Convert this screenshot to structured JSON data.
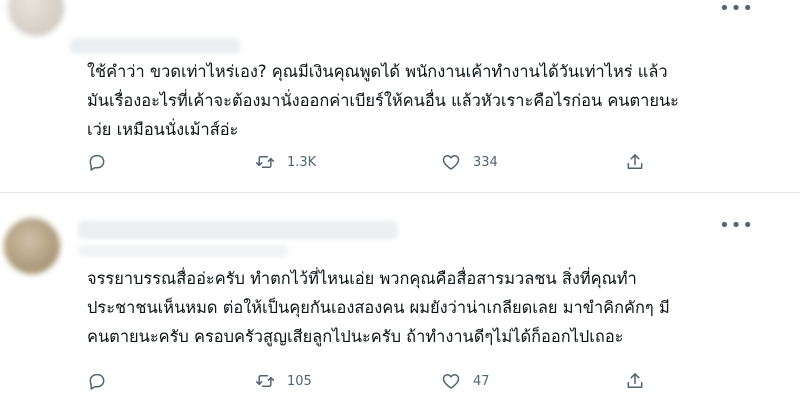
{
  "tweets": [
    {
      "more_label": "•••",
      "text_lines": [
        "ใช้คำว่า ขวดเท่าไหร่เอง? คุณมีเงินคุณพูดได้ พนักงานเค้าทำงานได้วันเท่าไหร่ แล้ว",
        "มันเรื่องอะไรที่เค้าจะต้องมานั่งออกค่าเบียร์ให้คนอื่น แล้วหัวเราะคือไรก่อน คนตายนะ",
        "เว่ย เหมือนนั่งเม้าส์อ่ะ"
      ],
      "reply_count": "",
      "retweet_count": "1.3K",
      "like_count": "334"
    },
    {
      "more_label": "•••",
      "text_lines": [
        "จรรยาบรรณสื่ออ่ะครับ ทำตกไว้ที่ไหนเอ่ย พวกคุณคือสื่อสารมวลชน สิ่งที่คุณทำ",
        "ประชาชนเห็นหมด ต่อให้เป็นคุยกันเองสองคน ผมยังว่าน่าเกลียดเลย มาขำคิกคักๆ มี",
        "คนตายนะครับ ครอบครัวสูญเสียลูกไปนะครับ  ถ้าทำงานดีๆไม่ได้ก็ออกไปเถอะ"
      ],
      "reply_count": "",
      "retweet_count": "105",
      "like_count": "47"
    }
  ],
  "icons": [
    "reply-icon",
    "retweet-icon",
    "like-icon",
    "share-icon",
    "more-icon"
  ],
  "colors": {
    "icon": "#536471",
    "text": "#0f1419",
    "divider": "#e6e9eb"
  }
}
